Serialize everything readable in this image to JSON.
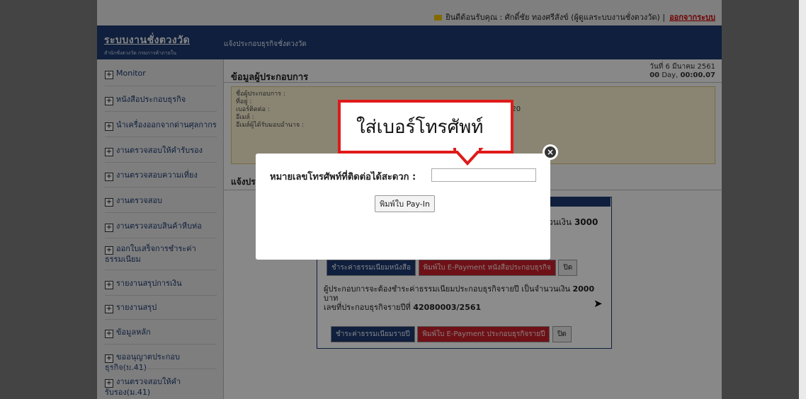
{
  "topbar": {
    "welcome_text": "ยินดีต้อนรับคุณ : ศักดิ์ชัย ทองศรีสังข์ (ผู้ดูแลระบบงานชั่งตวงวัด) |",
    "logout_label": "ออกจากระบบ"
  },
  "header": {
    "logo_title": "ระบบงานชั่งตวงวัด",
    "logo_subtitle": "สำนักชั่งตวงวัด กรมการค้าภายใน",
    "breadcrumb": "แจ้งประกอบธุรกิจชั่งตวงวัด"
  },
  "sidebar": {
    "items": [
      {
        "label": "Monitor"
      },
      {
        "label": "หนังสือประกอบธุรกิจ"
      },
      {
        "label": "นำเครื่องออกจากด่านศุลกากร"
      },
      {
        "label": "งานตรวจสอบให้คำรับรอง"
      },
      {
        "label": "งานตรวจสอบความเที่ยง"
      },
      {
        "label": "งานตรวจสอบ"
      },
      {
        "label": "งานตรวจสอบสินค้าหีบห่อ"
      },
      {
        "label": "ออกใบเสร็จการชำระค่าธรรมเนียม"
      },
      {
        "label": "รายงานสรุปการเงิน"
      },
      {
        "label": "รายงานสรุป"
      },
      {
        "label": "ข้อมูลหลัก"
      },
      {
        "label": "ขออนุญาตประกอบธุรกิจ(ม.41)"
      },
      {
        "label": "งานตรวจสอบให้คำรับรอง(ม.41)"
      }
    ]
  },
  "main": {
    "section_title": "ข้อมูลผู้ประกอบการ",
    "date_line1": "วันที่ 6 มีนาคม 2561",
    "date_line2_bold": "00",
    "date_line2_rest": "Day,",
    "date_line2_time": "00:00.07",
    "info_labels": [
      "ชื่อผู้ประกอบการ :",
      "ที่อยู่ :",
      "เบอร์ติดต่อ :",
      "อีเมล์ :",
      "อีเมล์ผู้ได้รับมอบอำนาจ :"
    ],
    "info_value": "120",
    "section2_title": "แจ้งประกอบ",
    "amount_text_prefix": "วนเงิน",
    "amount_value": "3000",
    "btn_pay_book": "ชำระค่าธรรมเนียมหนังสือ",
    "btn_epay_book": "พิมพ์ใบ E-Payment หนังสือประกอบธุรกิจ",
    "btn_close": "ปิด",
    "annual_text": "ผู้ประกอบการจะต้องชำระค่าธรรมเนียมประกอบธุรกิจรายปี เป็นจำนวนเงิน",
    "annual_amount": "2000",
    "annual_unit": "บาท",
    "annual_license_prefix": "เลขที่ประกอบธุรกิจรายปีที่",
    "annual_license_no": "42080003/2561",
    "btn_pay_annual": "ชำระค่าธรรมเนียมรายปี",
    "btn_epay_annual": "พิมพ์ใบ E-Payment ประกอบธุรกิจรายปี",
    "btn_close2": "ปิด"
  },
  "modal": {
    "phone_label": "หมายเลขโทรศัพท์ที่ติดต่อได้สะดวก :",
    "phone_value": "",
    "print_button": "พิมพ์ใบ Pay-In"
  },
  "callout": {
    "text": "ใส่เบอร์โทรศัพท์"
  },
  "colors": {
    "header_bg": "#1d3a6f",
    "callout_border": "#e01a1a",
    "epay_button": "#c8202a"
  }
}
